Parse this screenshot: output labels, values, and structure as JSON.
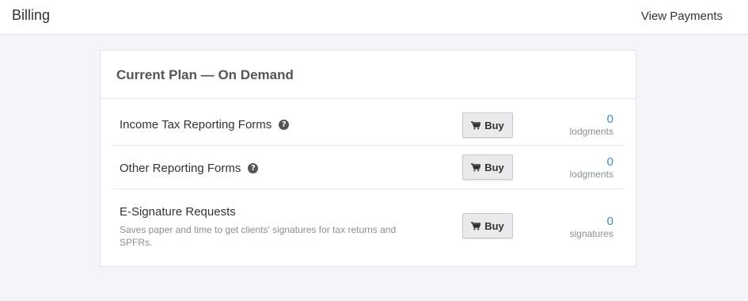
{
  "header": {
    "title": "Billing",
    "view_payments_label": "View Payments"
  },
  "plan": {
    "title": "Current Plan — On Demand",
    "items": [
      {
        "label": "Income Tax Reporting Forms",
        "has_help": true,
        "buy_label": "Buy",
        "count": "0",
        "unit": "lodgments"
      },
      {
        "label": "Other Reporting Forms",
        "has_help": true,
        "buy_label": "Buy",
        "count": "0",
        "unit": "lodgments"
      },
      {
        "label": "E-Signature Requests",
        "description": "Saves paper and time to get clients' signatures for tax returns and SPFRs.",
        "buy_label": "Buy",
        "count": "0",
        "unit": "signatures"
      }
    ]
  },
  "icons": {
    "help": "question-circle-icon",
    "buy": "cart-icon"
  },
  "colors": {
    "count": "#3a8ad6",
    "page_bg": "#f4f5f8"
  }
}
